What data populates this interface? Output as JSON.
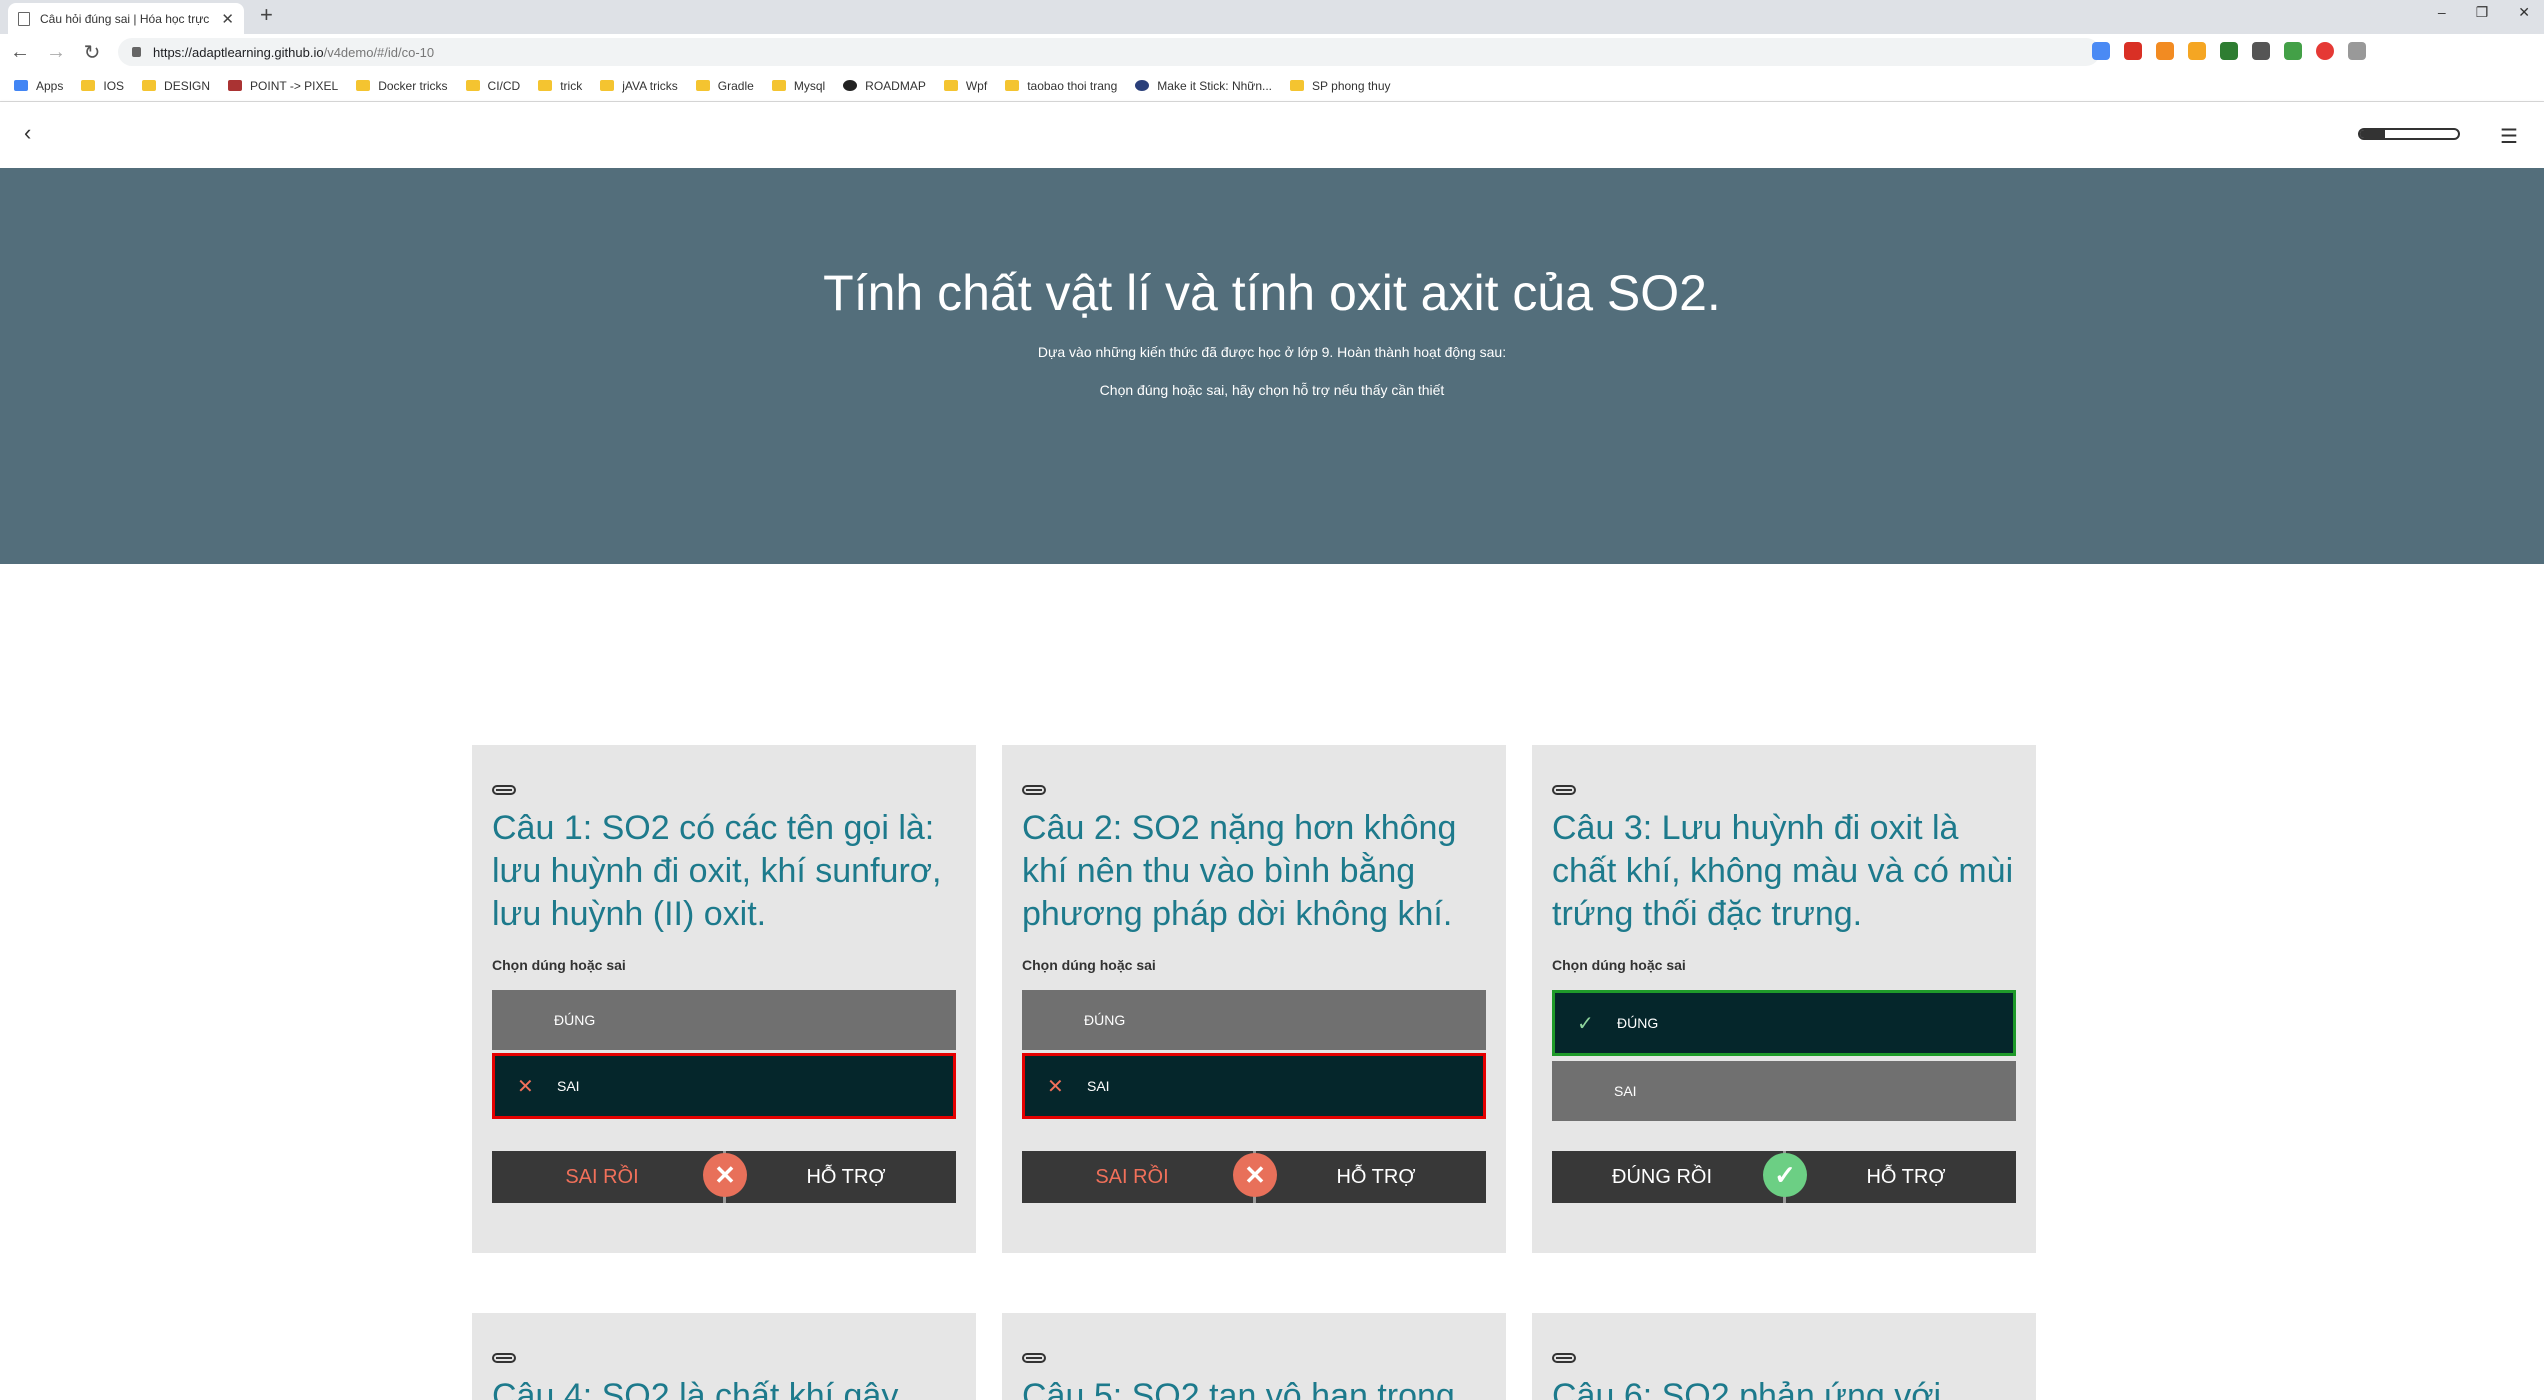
{
  "browser": {
    "tab_title": "Câu hỏi đúng sai | Hóa học trực",
    "url_host": "https://adaptlearning.github.io",
    "url_path": "/v4demo/#/id/co-10",
    "bookmarks": [
      "Apps",
      "IOS",
      "DESIGN",
      "POINT -> PIXEL",
      "Docker tricks",
      "CI/CD",
      "trick",
      "jAVA tricks",
      "Gradle",
      "Mysql",
      "ROADMAP",
      "Wpf",
      "taobao thoi trang",
      "Make it Stick: Nhữn...",
      "SP phong thuy"
    ]
  },
  "progress": 0.25,
  "hero": {
    "title": "Tính chất vật lí và tính oxit axit của SO2.",
    "line1": "Dựa vào những kiến thức đã được học ở lớp 9. Hoàn thành hoạt động sau:",
    "line2": "Chọn đúng hoặc sai, hãy chọn hỗ trợ nếu thấy cần thiết"
  },
  "instruction": "Chọn dúng hoặc sai",
  "labels": {
    "true": "ĐÚNG",
    "false": "SAI",
    "wrong": "SAI RỒI",
    "right": "ĐÚNG RỒI",
    "help": "HỖ TRỢ"
  },
  "cards": [
    {
      "q": "Câu 1: SO2 có các tên gọi là: lưu huỳnh đi oxit, khí sunfurơ, lưu huỳnh (II) oxit."
    },
    {
      "q": "Câu 2: SO2 nặng hơn không khí nên thu vào bình bằng phương pháp dời không khí."
    },
    {
      "q": "Câu 3: Lưu huỳnh đi oxit là chất khí, không màu và có mùi trứng thối đặc trưng."
    },
    {
      "q": "Câu 4: SO2 là chất khí gây"
    },
    {
      "q": "Câu 5: SO2 tan vô hạn trong"
    },
    {
      "q": "Câu 6: SO2 phản ứng với"
    }
  ]
}
